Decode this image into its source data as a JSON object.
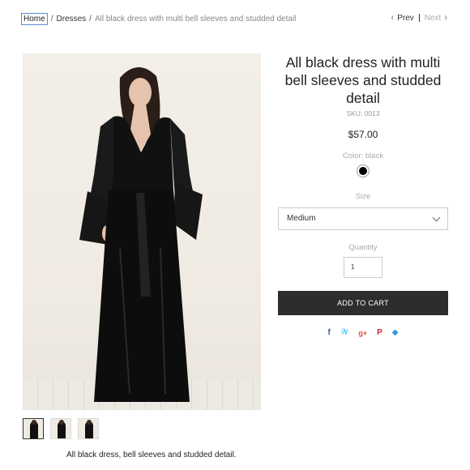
{
  "breadcrumb": {
    "home": "Home",
    "separator": "/",
    "category": "Dresses",
    "current": "All black dress with multi bell sleeves and studded detail"
  },
  "pager": {
    "prev": "Prev",
    "next": "Next"
  },
  "product": {
    "title": "All black dress with multi bell sleeves and studded detail",
    "sku": "SKU: 0013",
    "price": "$57.00",
    "color_label": "Color: black",
    "color_swatch": "#000000",
    "size_label": "Size",
    "size_value": "Medium",
    "quantity_label": "Quantity",
    "quantity_value": "1",
    "add_to_cart": "ADD TO CART",
    "description": "All black dress, bell sleeves and studded detail."
  },
  "share_icons": [
    "facebook-icon",
    "twitter-icon",
    "google-plus-icon",
    "pinterest-icon",
    "fancy-icon"
  ],
  "colors": {
    "cart_button": "#2d2d2d",
    "facebook": "#3b5998",
    "twitter": "#1da1f2",
    "google_plus": "#dd4b39",
    "pinterest": "#cb2027",
    "fancy": "#2a9ae2"
  }
}
